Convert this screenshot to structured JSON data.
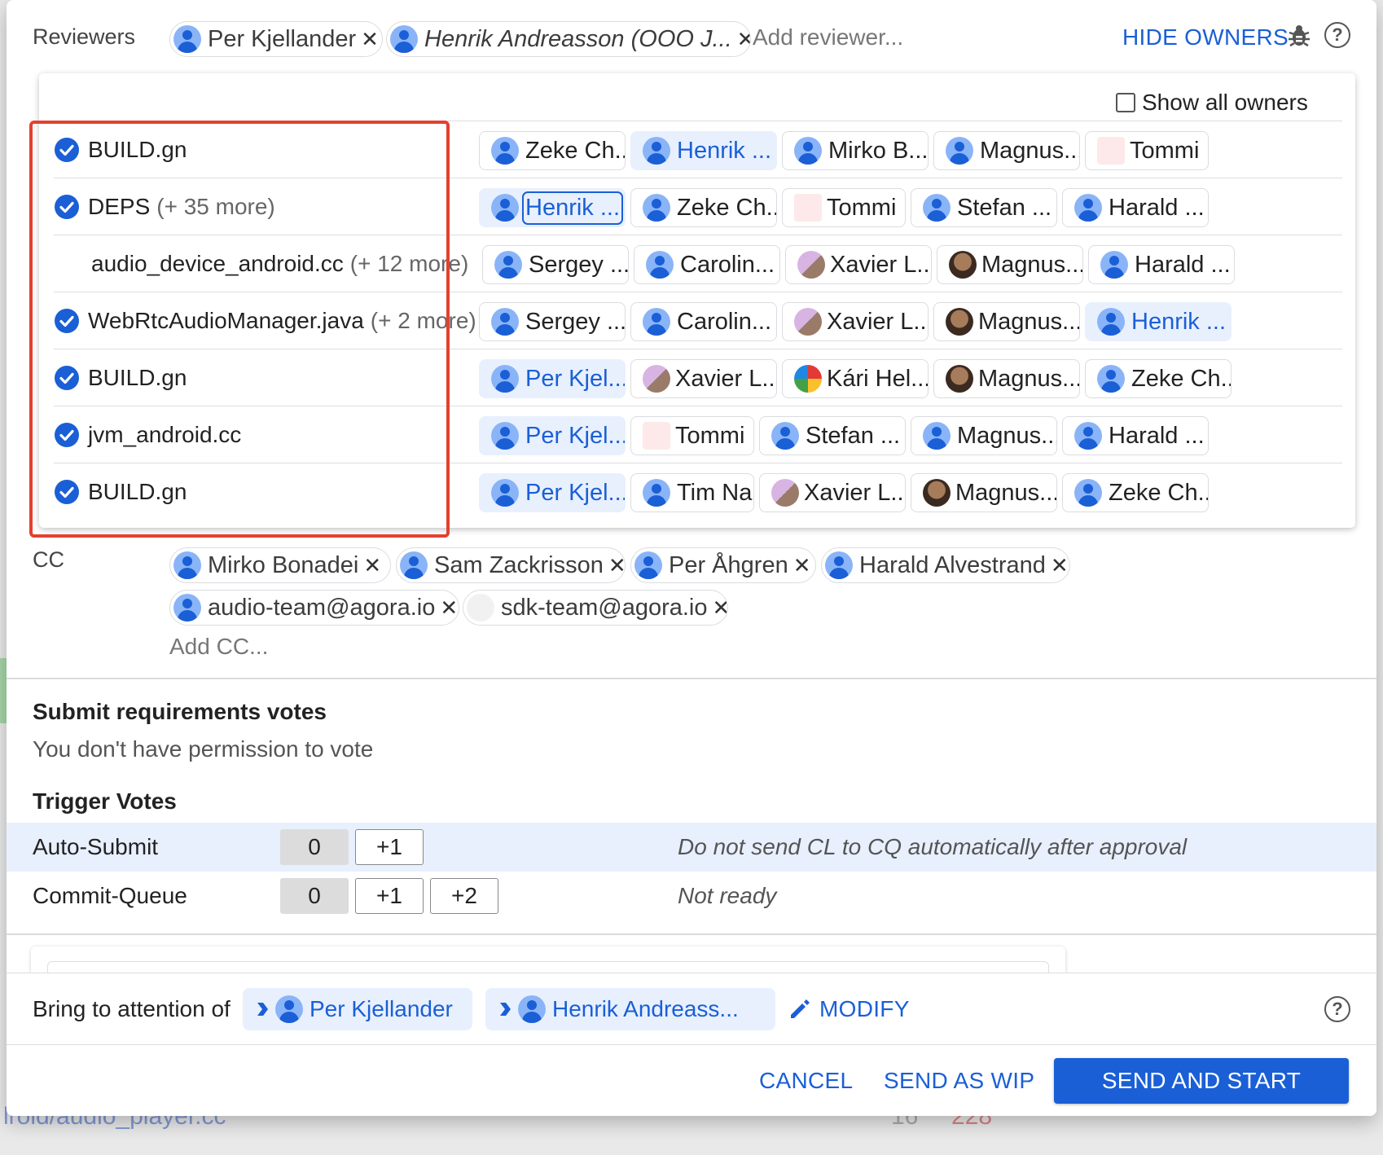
{
  "background": {
    "file_link": "lroid/audio_player.cc",
    "stats_left": "16",
    "stats_right": "228"
  },
  "reviewers": {
    "label": "Reviewers",
    "chips": [
      {
        "name": "Per Kjellander",
        "italic": false
      },
      {
        "name": "Henrik Andreasson (OOO J...",
        "italic": true
      }
    ],
    "add_placeholder": "Add reviewer...",
    "hide_owners_label": "HIDE OWNERS"
  },
  "owners": {
    "show_all_label": "Show all owners",
    "rows": [
      {
        "file": "BUILD.gn",
        "more": "",
        "checked": true,
        "owners": [
          {
            "name": "Zeke Ch...",
            "avatar": "default"
          },
          {
            "name": "Henrik ...",
            "avatar": "default",
            "selected": true
          },
          {
            "name": "Mirko B...",
            "avatar": "default"
          },
          {
            "name": "Magnus...",
            "avatar": "default"
          },
          {
            "name": "Tommi",
            "avatar": "tommi"
          }
        ]
      },
      {
        "file": "DEPS",
        "more": "(+ 35 more)",
        "checked": true,
        "owners": [
          {
            "name": "Henrik ...",
            "avatar": "default",
            "selected": true,
            "focused": true
          },
          {
            "name": "Zeke Ch...",
            "avatar": "default"
          },
          {
            "name": "Tommi",
            "avatar": "tommi"
          },
          {
            "name": "Stefan ...",
            "avatar": "default"
          },
          {
            "name": "Harald ...",
            "avatar": "default"
          }
        ]
      },
      {
        "file": "audio_device_android.cc",
        "more": "(+ 12 more)",
        "checked": false,
        "owners": [
          {
            "name": "Sergey ...",
            "avatar": "default"
          },
          {
            "name": "Carolin...",
            "avatar": "default"
          },
          {
            "name": "Xavier L...",
            "avatar": "cat"
          },
          {
            "name": "Magnus...",
            "avatar": "photo"
          },
          {
            "name": "Harald ...",
            "avatar": "default"
          }
        ]
      },
      {
        "file": "WebRtcAudioManager.java",
        "more": "(+ 2 more)",
        "checked": true,
        "owners": [
          {
            "name": "Sergey ...",
            "avatar": "default"
          },
          {
            "name": "Carolin...",
            "avatar": "default"
          },
          {
            "name": "Xavier L...",
            "avatar": "cat"
          },
          {
            "name": "Magnus...",
            "avatar": "photo"
          },
          {
            "name": "Henrik ...",
            "avatar": "default",
            "selected": true
          }
        ]
      },
      {
        "file": "BUILD.gn",
        "more": "",
        "checked": true,
        "owners": [
          {
            "name": "Per Kjel...",
            "avatar": "default",
            "selected": true
          },
          {
            "name": "Xavier L...",
            "avatar": "cat"
          },
          {
            "name": "Kári Hel...",
            "avatar": "logo"
          },
          {
            "name": "Magnus...",
            "avatar": "photo"
          },
          {
            "name": "Zeke Ch...",
            "avatar": "default"
          }
        ]
      },
      {
        "file": "jvm_android.cc",
        "more": "",
        "checked": true,
        "owners": [
          {
            "name": "Per Kjel...",
            "avatar": "default",
            "selected": true
          },
          {
            "name": "Tommi",
            "avatar": "tommi"
          },
          {
            "name": "Stefan ...",
            "avatar": "default"
          },
          {
            "name": "Magnus...",
            "avatar": "default"
          },
          {
            "name": "Harald ...",
            "avatar": "default"
          }
        ]
      },
      {
        "file": "BUILD.gn",
        "more": "",
        "checked": true,
        "owners": [
          {
            "name": "Per Kjel...",
            "avatar": "default",
            "selected": true
          },
          {
            "name": "Tim Na",
            "avatar": "default"
          },
          {
            "name": "Xavier L...",
            "avatar": "cat"
          },
          {
            "name": "Magnus...",
            "avatar": "photo"
          },
          {
            "name": "Zeke Ch...",
            "avatar": "default"
          }
        ]
      }
    ]
  },
  "cc": {
    "label": "CC",
    "chips": [
      {
        "name": "Mirko Bonadei",
        "avatar": "default"
      },
      {
        "name": "Sam Zackrisson",
        "avatar": "default"
      },
      {
        "name": "Per Åhgren",
        "avatar": "default"
      },
      {
        "name": "Harald Alvestrand",
        "avatar": "default"
      },
      {
        "name": "audio-team@agora.io",
        "avatar": "default"
      },
      {
        "name": "sdk-team@agora.io",
        "avatar": "blank"
      }
    ],
    "add_placeholder": "Add CC..."
  },
  "submit_requirements": {
    "heading": "Submit requirements votes",
    "message": "You don't have permission to vote"
  },
  "trigger_votes": {
    "heading": "Trigger Votes",
    "rows": [
      {
        "label": "Auto-Submit",
        "values": [
          "0",
          "+1"
        ],
        "selected": "0",
        "description": "Do not send CL to CQ automatically after approval",
        "highlighted": true
      },
      {
        "label": "Commit-Queue",
        "values": [
          "0",
          "+1",
          "+2"
        ],
        "selected": "0",
        "description": "Not ready",
        "highlighted": false
      }
    ]
  },
  "attention": {
    "label": "Bring to attention of",
    "chips": [
      "Per Kjellander",
      "Henrik Andreass..."
    ],
    "modify_label": "MODIFY"
  },
  "footer": {
    "cancel_label": "CANCEL",
    "wip_label": "SEND AS WIP",
    "send_label": "SEND AND START REVIEW"
  },
  "colors": {
    "accent": "#1a5fd6",
    "highlight": "#e8f0fe",
    "annotation_box": "#e3412f"
  }
}
